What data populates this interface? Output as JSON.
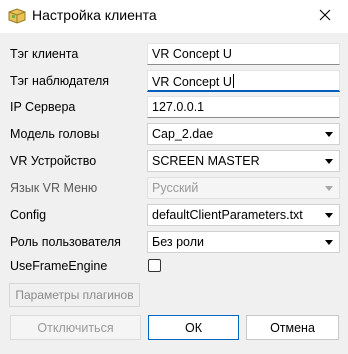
{
  "window": {
    "title": "Настройка клиента",
    "icons": {
      "app": "app-icon",
      "close": "close-icon"
    }
  },
  "form": {
    "client_tag": {
      "label": "Тэг клиента",
      "value": "VR Concept U"
    },
    "observer_tag": {
      "label": "Тэг наблюдателя",
      "value": "VR Concept U"
    },
    "server_ip": {
      "label": "IP Сервера",
      "value": "127.0.0.1"
    },
    "head_model": {
      "label": "Модель головы",
      "value": "Cap_2.dae"
    },
    "vr_device": {
      "label": "VR Устройство",
      "value": "SCREEN MASTER"
    },
    "vr_menu_language": {
      "label": "Язык VR Меню",
      "value": "Русский"
    },
    "config": {
      "label": "Config",
      "value": "defaultClientParameters.txt"
    },
    "user_role": {
      "label": "Роль пользователя",
      "value": "Без роли"
    },
    "use_frame_engine": {
      "label": "UseFrameEngine",
      "checked": false
    }
  },
  "buttons": {
    "plugin_params": "Параметры плагинов",
    "disconnect": "Отключиться",
    "ok": "ОК",
    "cancel": "Отмена"
  }
}
